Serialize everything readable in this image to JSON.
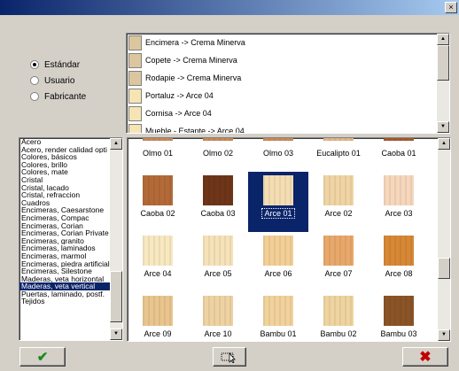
{
  "window": {
    "close_glyph": "×"
  },
  "source_options": [
    {
      "label": "Estándar",
      "checked": true
    },
    {
      "label": "Usuario",
      "checked": false
    },
    {
      "label": "Fabricante",
      "checked": false
    }
  ],
  "assignments": [
    {
      "text": "Encimera -> Crema Minerva",
      "color": "#dcc69e"
    },
    {
      "text": "Copete -> Crema Minerva",
      "color": "#dcc69e"
    },
    {
      "text": "Rodapie -> Crema Minerva",
      "color": "#dcc69e"
    },
    {
      "text": "Portaluz -> Arce 04",
      "color": "#f6e4b4"
    },
    {
      "text": "Cornisa -> Arce 04",
      "color": "#f6e4b4"
    },
    {
      "text": "Mueble - Estante -> Arce 04",
      "color": "#f6e4b4"
    }
  ],
  "categories": [
    {
      "label": "Acero",
      "selected": false
    },
    {
      "label": "Acero, render calidad opti",
      "selected": false
    },
    {
      "label": "Colores, básicos",
      "selected": false
    },
    {
      "label": "Colores, brillo",
      "selected": false
    },
    {
      "label": "Colores, mate",
      "selected": false
    },
    {
      "label": "Cristal",
      "selected": false
    },
    {
      "label": "Cristal, lacado",
      "selected": false
    },
    {
      "label": "Cristal, refraccion",
      "selected": false
    },
    {
      "label": "Cuadros",
      "selected": false
    },
    {
      "label": "Encimeras, Caesarstone",
      "selected": false
    },
    {
      "label": "Encimeras, Compac",
      "selected": false
    },
    {
      "label": "Encimeras, Corian",
      "selected": false
    },
    {
      "label": "Encimeras, Corian Private",
      "selected": false
    },
    {
      "label": "Encimeras, granito",
      "selected": false
    },
    {
      "label": "Encimeras, laminados",
      "selected": false
    },
    {
      "label": "Encimeras, marmol",
      "selected": false
    },
    {
      "label": "Encimeras, piedra artificial",
      "selected": false
    },
    {
      "label": "Encimeras, Silestone",
      "selected": false
    },
    {
      "label": "Maderas, veta horizontal",
      "selected": false
    },
    {
      "label": "Maderas, veta vertical",
      "selected": true
    },
    {
      "label": "Puertas, laminado, postf.",
      "selected": false
    },
    {
      "label": "Tejidos",
      "selected": false
    }
  ],
  "materials": [
    {
      "name": "Olmo 01",
      "color": "#c98a5a"
    },
    {
      "name": "Olmo 02",
      "color": "#c98a5a"
    },
    {
      "name": "Olmo 03",
      "color": "#c98a5a"
    },
    {
      "name": "Eucalipto 01",
      "color": "#e1b78c"
    },
    {
      "name": "Caoba 01",
      "color": "#a45a2c"
    },
    {
      "name": "Caoba 02",
      "color": "#b36a38"
    },
    {
      "name": "Caoba 03",
      "color": "#6e3518"
    },
    {
      "name": "Arce 01",
      "color": "#f4ddb2",
      "selected": true
    },
    {
      "name": "Arce 02",
      "color": "#f0d4a4"
    },
    {
      "name": "Arce 03",
      "color": "#f6d7bc"
    },
    {
      "name": "Arce 04",
      "color": "#f8e8c0"
    },
    {
      "name": "Arce 05",
      "color": "#f6e2b8"
    },
    {
      "name": "Arce 06",
      "color": "#f2cf96"
    },
    {
      "name": "Arce 07",
      "color": "#e8a86a"
    },
    {
      "name": "Arce 08",
      "color": "#d78835"
    },
    {
      "name": "Arce 09",
      "color": "#e9c58e"
    },
    {
      "name": "Arce 10",
      "color": "#eed2a2"
    },
    {
      "name": "Bambu 01",
      "color": "#f2d29c"
    },
    {
      "name": "Bambu 02",
      "color": "#efd4a0"
    },
    {
      "name": "Bambu 03",
      "color": "#8b5426"
    }
  ],
  "buttons": {
    "ok_glyph": "✔",
    "cancel_glyph": "✖",
    "ok_icon": "checkmark-icon",
    "cancel_icon": "cross-icon",
    "pick_icon": "pointer-cursor-icon"
  }
}
